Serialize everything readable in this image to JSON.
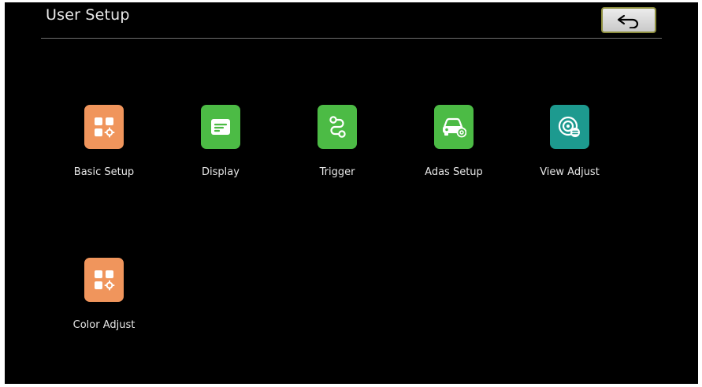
{
  "header": {
    "title": "User Setup",
    "back_icon": "back-arrow-icon"
  },
  "menu": {
    "items": [
      {
        "label": "Basic Setup",
        "icon": "grid-settings-icon",
        "color": "#f0955c"
      },
      {
        "label": "Display",
        "icon": "display-icon",
        "color": "#4cbb45"
      },
      {
        "label": "Trigger",
        "icon": "trigger-route-icon",
        "color": "#4cbb45"
      },
      {
        "label": "Adas Setup",
        "icon": "car-icon",
        "color": "#4cbb45"
      },
      {
        "label": "View Adjust",
        "icon": "view-adjust-icon",
        "color": "#1d9a8f"
      },
      {
        "label": "Color Adjust",
        "icon": "grid-settings-icon",
        "color": "#f0955c"
      }
    ]
  },
  "colors": {
    "background": "#000000",
    "text": "#e6e6e6",
    "back_button_border": "#8d8e3e"
  }
}
